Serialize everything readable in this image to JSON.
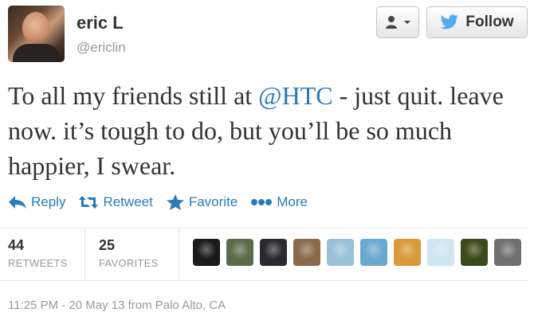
{
  "user": {
    "display_name": "eric L",
    "handle": "@ericlin"
  },
  "buttons": {
    "follow_label": "Follow"
  },
  "tweet": {
    "text_before": "To all my friends still at ",
    "mention": "@HTC",
    "text_after": " - just quit. leave now. it’s tough to do, but you’ll be so much happier, I swear."
  },
  "actions": [
    {
      "label": "Reply",
      "icon": "reply-icon"
    },
    {
      "label": "Retweet",
      "icon": "retweet-icon"
    },
    {
      "label": "Favorite",
      "icon": "star-icon"
    },
    {
      "label": "More",
      "icon": "more-dots-icon"
    }
  ],
  "stats": {
    "retweets_count": "44",
    "retweets_label": "RETWEETS",
    "favorites_count": "25",
    "favorites_label": "FAVORITES"
  },
  "favoriters": [
    {
      "name": "favoriter-avatar-1",
      "color": "#1a1a1a"
    },
    {
      "name": "favoriter-avatar-2",
      "color": "#5b6b4a"
    },
    {
      "name": "favoriter-avatar-3",
      "color": "#2a2a30"
    },
    {
      "name": "favoriter-avatar-4",
      "color": "#8a6a4a"
    },
    {
      "name": "favoriter-avatar-5",
      "color": "#9ac0d8"
    },
    {
      "name": "favoriter-avatar-6",
      "color": "#6aa8d0"
    },
    {
      "name": "favoriter-avatar-7",
      "color": "#d89a3a"
    },
    {
      "name": "favoriter-avatar-8",
      "color": "#cfe6f0"
    },
    {
      "name": "favoriter-avatar-9",
      "color": "#3a4a1a"
    },
    {
      "name": "favoriter-avatar-10",
      "color": "#707070"
    }
  ],
  "meta": {
    "timestamp": "11:25 PM - 20 May 13 from Palo Alto, CA"
  },
  "colors": {
    "link": "#2b7bb9",
    "twitter_bird": "#55acee",
    "muted": "#999999"
  }
}
